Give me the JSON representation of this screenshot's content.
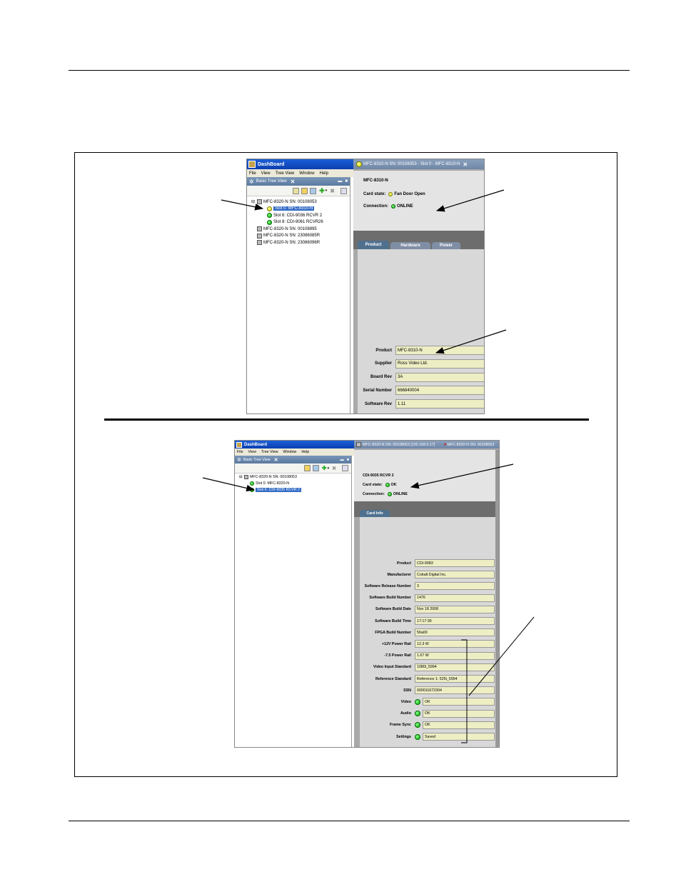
{
  "top": {
    "window_title": "DashBoard",
    "menu": [
      "File",
      "View",
      "Tree View",
      "Window",
      "Help"
    ],
    "tree_tab": "Basic Tree View",
    "tree": [
      {
        "label": "MFC-8320-N SN: 00108053",
        "kind": "frame"
      },
      {
        "label": "Slot 0: MFC-8310-N",
        "kind": "yellow",
        "selected": true
      },
      {
        "label": "Slot 6: CDI-9036 RCVR 2",
        "kind": "green"
      },
      {
        "label": "Slot 8: CDI-9061 RCVR26",
        "kind": "green"
      },
      {
        "label": "MFC-8320-N SN: 00108895",
        "kind": "frame"
      },
      {
        "label": "MFC-8320-N SN: 23086085R",
        "kind": "frame"
      },
      {
        "label": "MFC-8320-N SN: 23086096R",
        "kind": "frame"
      }
    ],
    "right_tab": "MFC-8310-N SN: 00108053 - Slot 0 - MFC-8310-N",
    "card_name": "MFC-8310-N",
    "card_state_label": "Card state:",
    "card_state_value": "Fan Door Open",
    "connection_label": "Connection:",
    "connection_value": "ONLINE",
    "subtabs": [
      "Product",
      "Hardware",
      "Power"
    ],
    "fields": [
      {
        "label": "Product",
        "value": "MFC-8310-N"
      },
      {
        "label": "Supplier",
        "value": "Ross Video Ltd."
      },
      {
        "label": "Board Rev",
        "value": "3A"
      },
      {
        "label": "Serial Number",
        "value": "666840004"
      },
      {
        "label": "Software Rev",
        "value": "1.11"
      }
    ]
  },
  "bottom": {
    "window_title": "DashBoard",
    "menu": [
      "File",
      "View",
      "Tree View",
      "Window",
      "Help"
    ],
    "tree_tab": "Basic Tree View",
    "tree": [
      {
        "label": "MFC-8320-N SN: 00108053",
        "kind": "frame"
      },
      {
        "label": "Slot 0: MFC-8320-N",
        "kind": "green"
      },
      {
        "label": "Slot 6: CDI-9035 RCVR 2",
        "kind": "green",
        "selected": true
      }
    ],
    "right_tab": "MFC-8320-N SN: 00108053 [192.168.0.17]",
    "right_tab2": "MFC-8320-N SN: 00108053",
    "card_name": "CDI-9035 RCVR 2",
    "card_state_label": "Card state:",
    "card_state_value": "OK",
    "connection_label": "Connection:",
    "connection_value": "ONLINE",
    "subtabs": [
      "Card Info"
    ],
    "fields": [
      {
        "label": "Product",
        "value": "CDI-9083"
      },
      {
        "label": "Manufacturer",
        "value": "Cobalt Digital Inc."
      },
      {
        "label": "Software Release Number",
        "value": "3"
      },
      {
        "label": "Software Build Number",
        "value": "1476"
      },
      {
        "label": "Software Build Date",
        "value": "Nov 18 2008"
      },
      {
        "label": "Software Build Time",
        "value": "17:17:39"
      },
      {
        "label": "FPGA Build Number",
        "value": "56a00"
      },
      {
        "label": "+12V Power Rail",
        "value": "12.3 W"
      },
      {
        "label": "-7.5 Power Rail",
        "value": "1.67 W"
      },
      {
        "label": "Video Input Standard",
        "value": "1080i_5994"
      },
      {
        "label": "Reference Standard",
        "value": "Reference 1: 525i_5994"
      },
      {
        "label": "SSN",
        "value": "000011672304"
      },
      {
        "label": "Video",
        "value": "OK",
        "led": true
      },
      {
        "label": "Audio",
        "value": "OK",
        "led": true
      },
      {
        "label": "Frame Sync",
        "value": "OK",
        "led": true
      },
      {
        "label": "Settings",
        "value": "Saved",
        "led": true
      }
    ]
  }
}
